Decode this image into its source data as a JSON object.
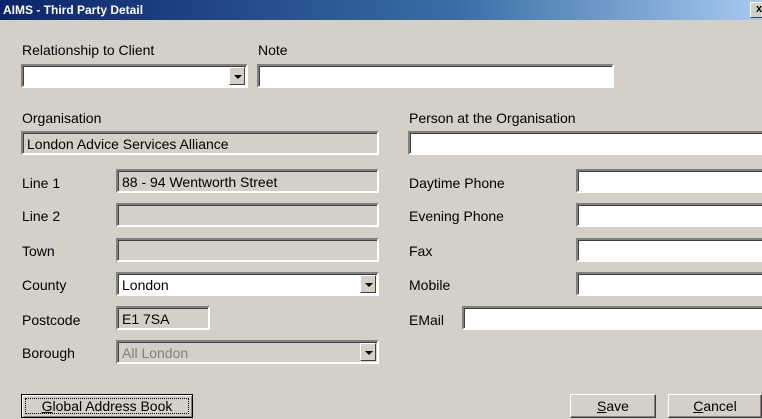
{
  "window": {
    "title": "AIMS - Third Party Detail",
    "close": "x"
  },
  "relationship": {
    "label": "Relationship to Client",
    "value": ""
  },
  "note": {
    "label": "Note",
    "value": ""
  },
  "organisation": {
    "label": "Organisation",
    "value": "London Advice Services Alliance"
  },
  "person": {
    "label": "Person at the Organisation",
    "value": ""
  },
  "address": {
    "line1": {
      "label": "Line 1",
      "value": "88 - 94 Wentworth Street"
    },
    "line2": {
      "label": "Line 2",
      "value": ""
    },
    "town": {
      "label": "Town",
      "value": ""
    },
    "county": {
      "label": "County",
      "value": "London"
    },
    "postcode": {
      "label": "Postcode",
      "value": "E1 7SA"
    },
    "borough": {
      "label": "Borough",
      "value": "All London"
    }
  },
  "contact": {
    "daytime": {
      "label": "Daytime Phone",
      "value": ""
    },
    "evening": {
      "label": "Evening Phone",
      "value": ""
    },
    "fax": {
      "label": "Fax",
      "value": ""
    },
    "mobile": {
      "label": "Mobile",
      "value": ""
    },
    "email": {
      "label": "EMail",
      "value": ""
    }
  },
  "buttons": {
    "global_first": "G",
    "global_rest": "lobal Address Book",
    "save_first": "S",
    "save_rest": "ave",
    "cancel_first": "C",
    "cancel_rest": "ancel"
  }
}
